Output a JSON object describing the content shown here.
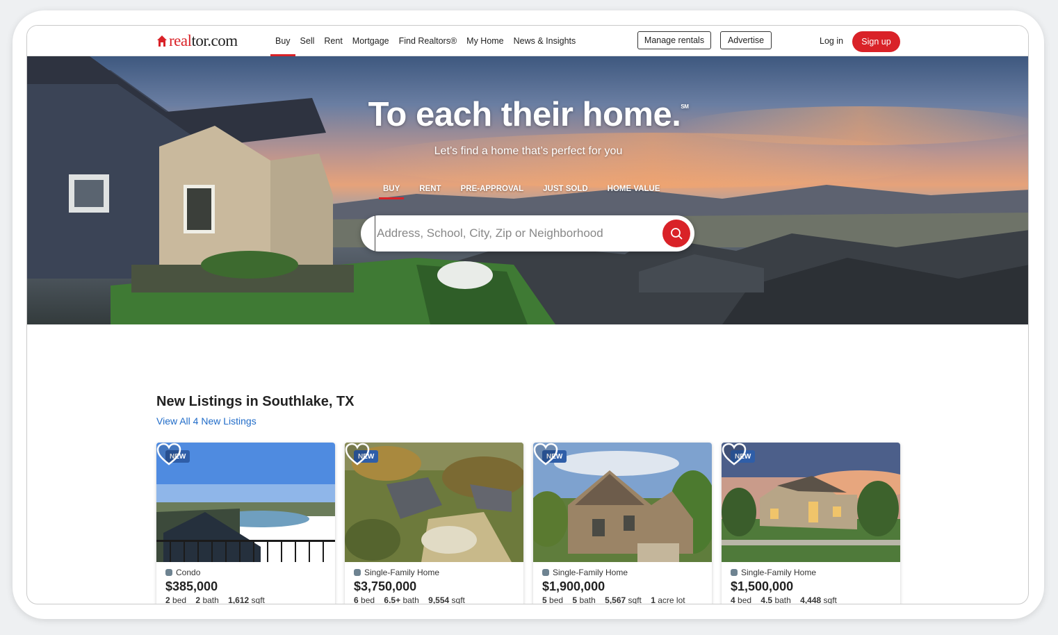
{
  "header": {
    "logo_text_red": "real",
    "logo_text_dark": "tor.com",
    "nav": [
      {
        "label": "Buy",
        "active": true
      },
      {
        "label": "Sell",
        "active": false
      },
      {
        "label": "Rent",
        "active": false
      },
      {
        "label": "Mortgage",
        "active": false
      },
      {
        "label": "Find Realtors®",
        "active": false
      },
      {
        "label": "My Home",
        "active": false
      },
      {
        "label": "News & Insights",
        "active": false
      }
    ],
    "manage_rentals": "Manage rentals",
    "advertise": "Advertise",
    "login": "Log in",
    "signup": "Sign up"
  },
  "hero": {
    "title": "To each their home.",
    "title_mark": "SM",
    "subtitle": "Let’s find a home that’s perfect for you",
    "tabs": [
      {
        "label": "BUY",
        "active": true
      },
      {
        "label": "RENT",
        "active": false
      },
      {
        "label": "PRE-APPROVAL",
        "active": false
      },
      {
        "label": "JUST SOLD",
        "active": false
      },
      {
        "label": "HOME VALUE",
        "active": false
      }
    ],
    "search_placeholder": "Address, School, City, Zip or Neighborhood"
  },
  "listings": {
    "title": "New Listings in Southlake, TX",
    "view_all": "View All 4 New Listings",
    "cards": [
      {
        "badge": "NEW",
        "type": "Condo",
        "price": "$385,000",
        "specs": [
          [
            "2",
            "bed"
          ],
          [
            "2",
            "bath"
          ],
          [
            "1,612",
            "sqft"
          ]
        ]
      },
      {
        "badge": "NEW",
        "type": "Single-Family Home",
        "price": "$3,750,000",
        "specs": [
          [
            "6",
            "bed"
          ],
          [
            "6.5+",
            "bath"
          ],
          [
            "9,554",
            "sqft"
          ]
        ]
      },
      {
        "badge": "NEW",
        "type": "Single-Family Home",
        "price": "$1,900,000",
        "specs": [
          [
            "5",
            "bed"
          ],
          [
            "5",
            "bath"
          ],
          [
            "5,567",
            "sqft"
          ],
          [
            "1",
            "acre lot"
          ]
        ]
      },
      {
        "badge": "NEW",
        "type": "Single-Family Home",
        "price": "$1,500,000",
        "specs": [
          [
            "4",
            "bed"
          ],
          [
            "4.5",
            "bath"
          ],
          [
            "4,448",
            "sqft"
          ]
        ]
      }
    ]
  },
  "colors": {
    "brand_red": "#d92228",
    "link_blue": "#1f6bc8",
    "badge_blue": "#2f5ea8"
  }
}
